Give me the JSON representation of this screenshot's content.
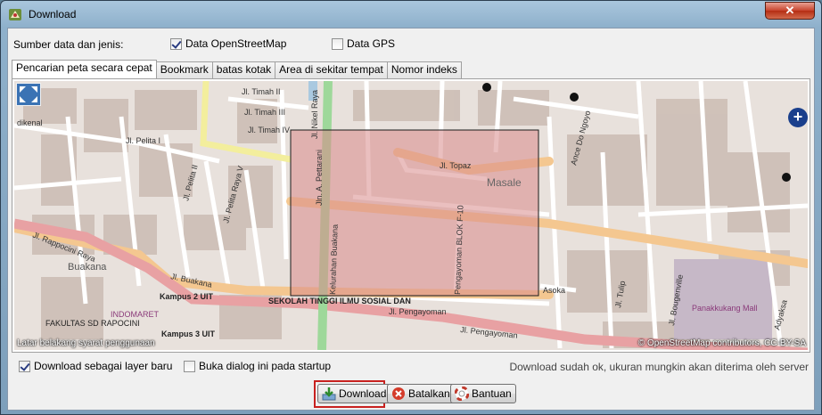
{
  "window": {
    "title": "Download",
    "close_label": "✕"
  },
  "source": {
    "label": "Sumber data dan jenis:",
    "osm_label": "Data OpenStreetMap",
    "osm_checked": true,
    "gps_label": "Data GPS",
    "gps_checked": false
  },
  "tabs": [
    {
      "label": "Pencarian peta secara cepat",
      "active": true
    },
    {
      "label": "Bookmark",
      "active": false
    },
    {
      "label": "batas kotak",
      "active": false
    },
    {
      "label": "Area di sekitar tempat",
      "active": false
    },
    {
      "label": "Nomor indeks",
      "active": false
    }
  ],
  "map": {
    "attribution_left": "Latar belakang syarat penggunaan",
    "attribution_right": "© OpenStreetMap contributors, CC-BY-SA",
    "labels": {
      "rappocini_raya": "Jl. Rappocini Raya",
      "buakana": "Buakana",
      "jl_buakana": "Jl. Buakana",
      "pengayoman1": "Jl. Pengayoman",
      "pengayoman2": "Jl. Pengayoman",
      "pettarani": "Jln. A. Pettarani",
      "nikel_raya": "Jl. Nikel Raya",
      "masale": "Masale",
      "topaz": "Jl. Topaz",
      "pelita2": "Jl. Pelita II",
      "pelita5": "Jl. Pelita Raya V",
      "timah2": "Jl. Timah II",
      "timah3": "Jl. Timah III",
      "timah4": "Jl. Timah IV",
      "asoka": "Asoka",
      "tulip": "Jl. Tulip",
      "bougenville": "Jl. Bougenville",
      "panakkukang": "Panakkukang Mall",
      "kampus2": "Kampus 2 UIT",
      "kampus3": "Kampus 3 UIT",
      "indomaret": "INDOMARET",
      "fakultas": "FAKULTAS SD RAPOCINI",
      "sekolah": "SEKOLAH TINGGI ILMU SOSIAL DAN",
      "dikenal": "dikenal",
      "kelurahan": "Kelurahan Buakana",
      "pengayoman_blok": "Pengayoman BLOK F-10",
      "ance_ngoyo": "Ance Do Ngoyo",
      "adyaksa": "Adyaksa",
      "pelita1": "Jl. Pelita I"
    },
    "accent_selection": "#d98b8b"
  },
  "options": {
    "new_layer_label": "Download sebagai layer baru",
    "new_layer_checked": true,
    "open_startup_label": "Buka dialog ini pada startup",
    "open_startup_checked": false
  },
  "status_text": "Download sudah ok, ukuran mungkin akan diterima oleh server",
  "buttons": {
    "download": "Download",
    "cancel": "Batalkan",
    "help": "Bantuan"
  }
}
